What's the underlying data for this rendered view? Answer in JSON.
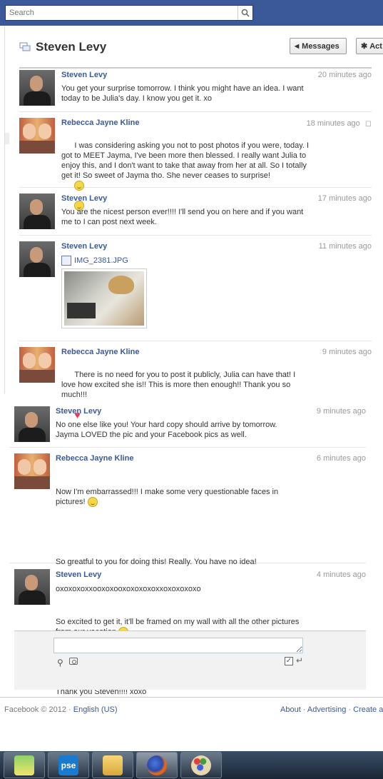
{
  "search": {
    "placeholder": "Search"
  },
  "thread": {
    "title": "Steven Levy",
    "messages_button": "Messages",
    "actions_button": "Act"
  },
  "messages": [
    {
      "author": "Steven Levy",
      "time": "20 minutes ago",
      "text": "You get your surprise tomorrow. I think you might have an idea. I want today to be Julia's day. I know you get it. xo"
    },
    {
      "author": "Rebecca Jayne Kline",
      "time": "18 minutes ago",
      "text": "I was considering asking you not to post photos if you were, today. I got to MEET Jayma, I've been more then blessed. I really want Julia to enjoy this, and I don't want to take that away from her at all. So I totally get it! So sweet of Jayma tho. She never ceases to surprise!"
    },
    {
      "author": "Steven Levy",
      "time": "17 minutes ago",
      "text": "You are the nicest person ever!!!! I'll send you on here and if you want me to I can post next week."
    },
    {
      "author": "Steven Levy",
      "time": "11 minutes ago",
      "attachment": "IMG_2381.JPG"
    },
    {
      "author": "Rebecca Jayne Kline",
      "time": "9 minutes ago",
      "text": "There is no need for you to post it publicly, Julia can have that! I love how excited she is!! This is more then enough!! Thank you so much!!!"
    },
    {
      "author": "Steven Levy",
      "time": "9 minutes ago",
      "text": "No one else like you! Your hard copy should arrive by tomorrow. Jayma LOVED the pic and your Facebook pics as well."
    },
    {
      "author": "Rebecca Jayne Kline",
      "time": "6 minutes ago",
      "text_lines": [
        "Now I'm embarrassed!!! I make some very questionable faces in pictures!",
        "So greatful to you for doing this! Really. You have no idea!",
        "So excited to get it, it'll be framed on my wall with all the other pictures from our vacation",
        "Thank you Steven!!!! xoxo"
      ]
    },
    {
      "author": "Steven Levy",
      "time": "4 minutes ago",
      "text": "oxoxoxoxxooxoxooxoxoxoxoxxoxoxoxoxo"
    }
  ],
  "footer": {
    "copyright": "Facebook © 2012 ·",
    "language": "English (US)",
    "about": "About",
    "advertising": "Advertising",
    "create": "Create a"
  },
  "taskbar": {
    "pse_label": "pse"
  }
}
